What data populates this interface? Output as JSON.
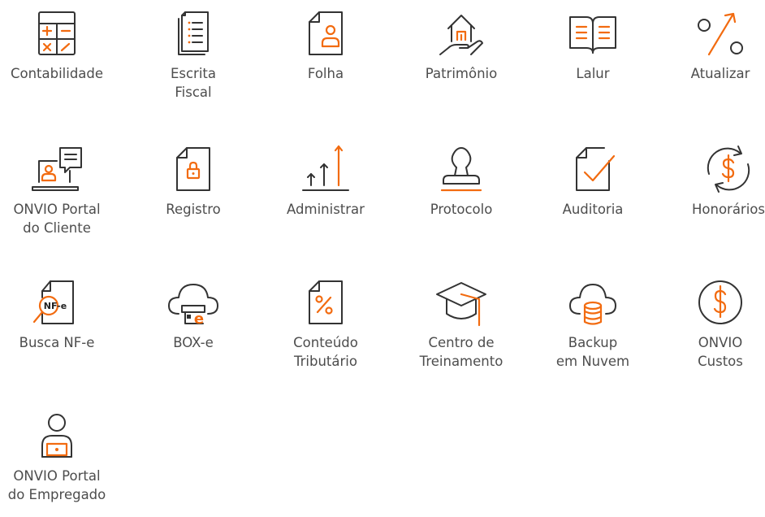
{
  "colors": {
    "accent": "#f26b10",
    "stroke": "#333333",
    "text": "#4d4d4d"
  },
  "tiles": [
    {
      "icon": "calculator-icon",
      "line1": "Contabilidade",
      "line2": ""
    },
    {
      "icon": "documents-list-icon",
      "line1": "Escrita",
      "line2": "Fiscal"
    },
    {
      "icon": "document-person-icon",
      "line1": "Folha",
      "line2": ""
    },
    {
      "icon": "house-hand-icon",
      "line1": "Patrimônio",
      "line2": ""
    },
    {
      "icon": "open-book-icon",
      "line1": "Lalur",
      "line2": ""
    },
    {
      "icon": "percent-arrow-icon",
      "line1": "Atualizar",
      "line2": ""
    },
    {
      "icon": "laptop-chat-icon",
      "line1": "ONVIO Portal",
      "line2": "do Cliente"
    },
    {
      "icon": "document-lock-icon",
      "line1": "Registro",
      "line2": ""
    },
    {
      "icon": "arrows-up-icon",
      "line1": "Administrar",
      "line2": ""
    },
    {
      "icon": "stamp-icon",
      "line1": "Protocolo",
      "line2": ""
    },
    {
      "icon": "document-check-icon",
      "line1": "Auditoria",
      "line2": ""
    },
    {
      "icon": "dollar-cycle-icon",
      "line1": "Honorários",
      "line2": ""
    },
    {
      "icon": "nfe-search-icon",
      "line1": "Busca NF-e",
      "line2": "",
      "badge": "NF-e"
    },
    {
      "icon": "cloud-box-icon",
      "line1": "BOX-e",
      "line2": ""
    },
    {
      "icon": "document-percent-icon",
      "line1": "Conteúdo",
      "line2": "Tributário"
    },
    {
      "icon": "graduation-cap-icon",
      "line1": "Centro de",
      "line2": "Treinamento"
    },
    {
      "icon": "cloud-database-icon",
      "line1": "Backup",
      "line2": "em Nuvem"
    },
    {
      "icon": "dollar-circle-icon",
      "line1": "ONVIO",
      "line2": "Custos"
    },
    {
      "icon": "employee-laptop-icon",
      "line1": "ONVIO Portal",
      "line2": "do Empregado"
    }
  ]
}
